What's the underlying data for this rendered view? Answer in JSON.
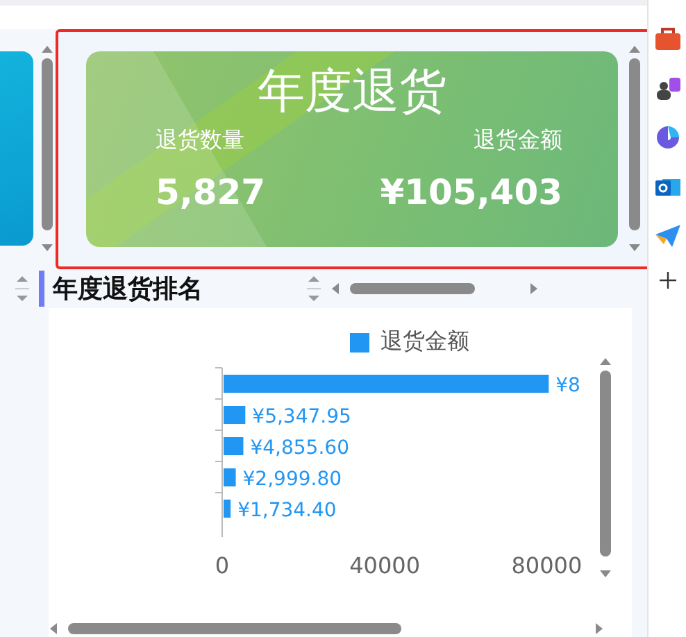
{
  "summary_card": {
    "title": "年度退货",
    "metrics": [
      {
        "label": "退货数量",
        "value": "5,827"
      },
      {
        "label": "退货金额",
        "value": "¥105,403"
      }
    ]
  },
  "ranking": {
    "heading": "年度退货排名",
    "chart_data": {
      "type": "bar",
      "orientation": "horizontal",
      "series": [
        {
          "name": "退货金额",
          "color": "#2196f3",
          "values": [
            80000,
            5350,
            4860,
            3000,
            1730
          ]
        }
      ],
      "xlim": [
        0,
        82000
      ],
      "xticks": [
        0,
        40000,
        80000
      ],
      "value_labels": [
        "¥8",
        "¥5,347.95",
        "¥4,855.60",
        "¥2,999.80",
        "¥1,734.40"
      ]
    }
  }
}
